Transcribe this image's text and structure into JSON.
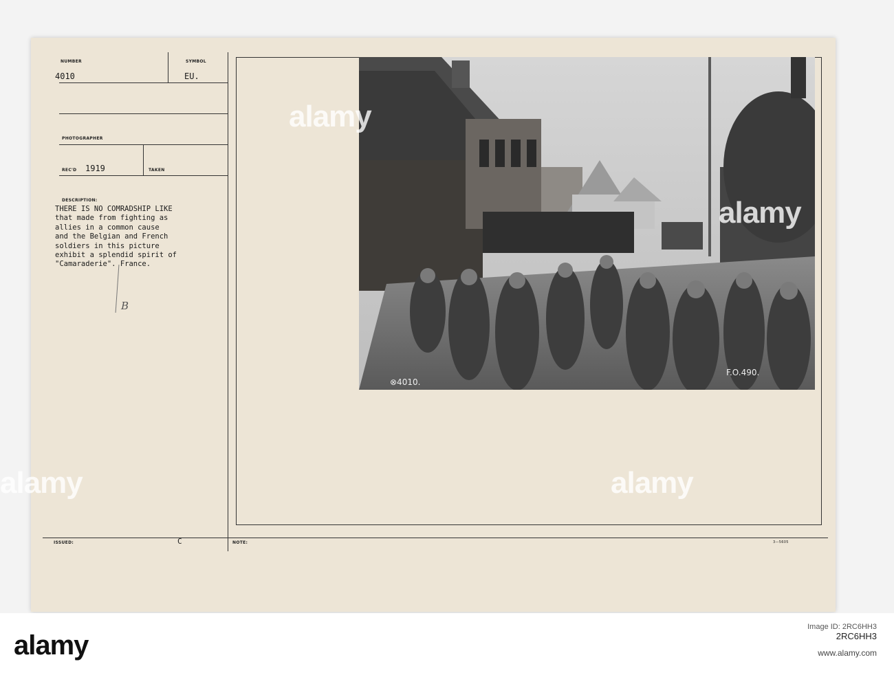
{
  "card": {
    "number_label": "NUMBER",
    "number_value": "4010",
    "symbol_label": "SYMBOL",
    "symbol_value": "EU.",
    "photographer_label": "PHOTOGRAPHER",
    "recd_label": "REC'D",
    "recd_value": "1919",
    "taken_label": "TAKEN",
    "description_label": "DESCRIPTION:",
    "description_lines": [
      "THERE IS NO COMRADSHIP LIKE",
      "that made from fighting as",
      "allies in a common cause",
      "and the Belgian and French",
      "soldiers in this picture",
      "exhibit a splendid spirit of",
      "\"Camaraderie\". France."
    ],
    "handwritten_mark": "B",
    "issued_label": "ISSUED:",
    "c_mark": "C",
    "note_label": "NOTE:",
    "form_code": "3—5605"
  },
  "photo": {
    "left_number": "⊗4010.",
    "right_number": "F.O.490."
  },
  "watermarks": [
    "alamy",
    "alamy",
    "alamy",
    "alamy"
  ],
  "bottom_strip": {
    "logo": "alamy",
    "image_id": "Image ID: 2RC6HH3",
    "code": "2RC6HH3",
    "site": "www.alamy.com"
  }
}
